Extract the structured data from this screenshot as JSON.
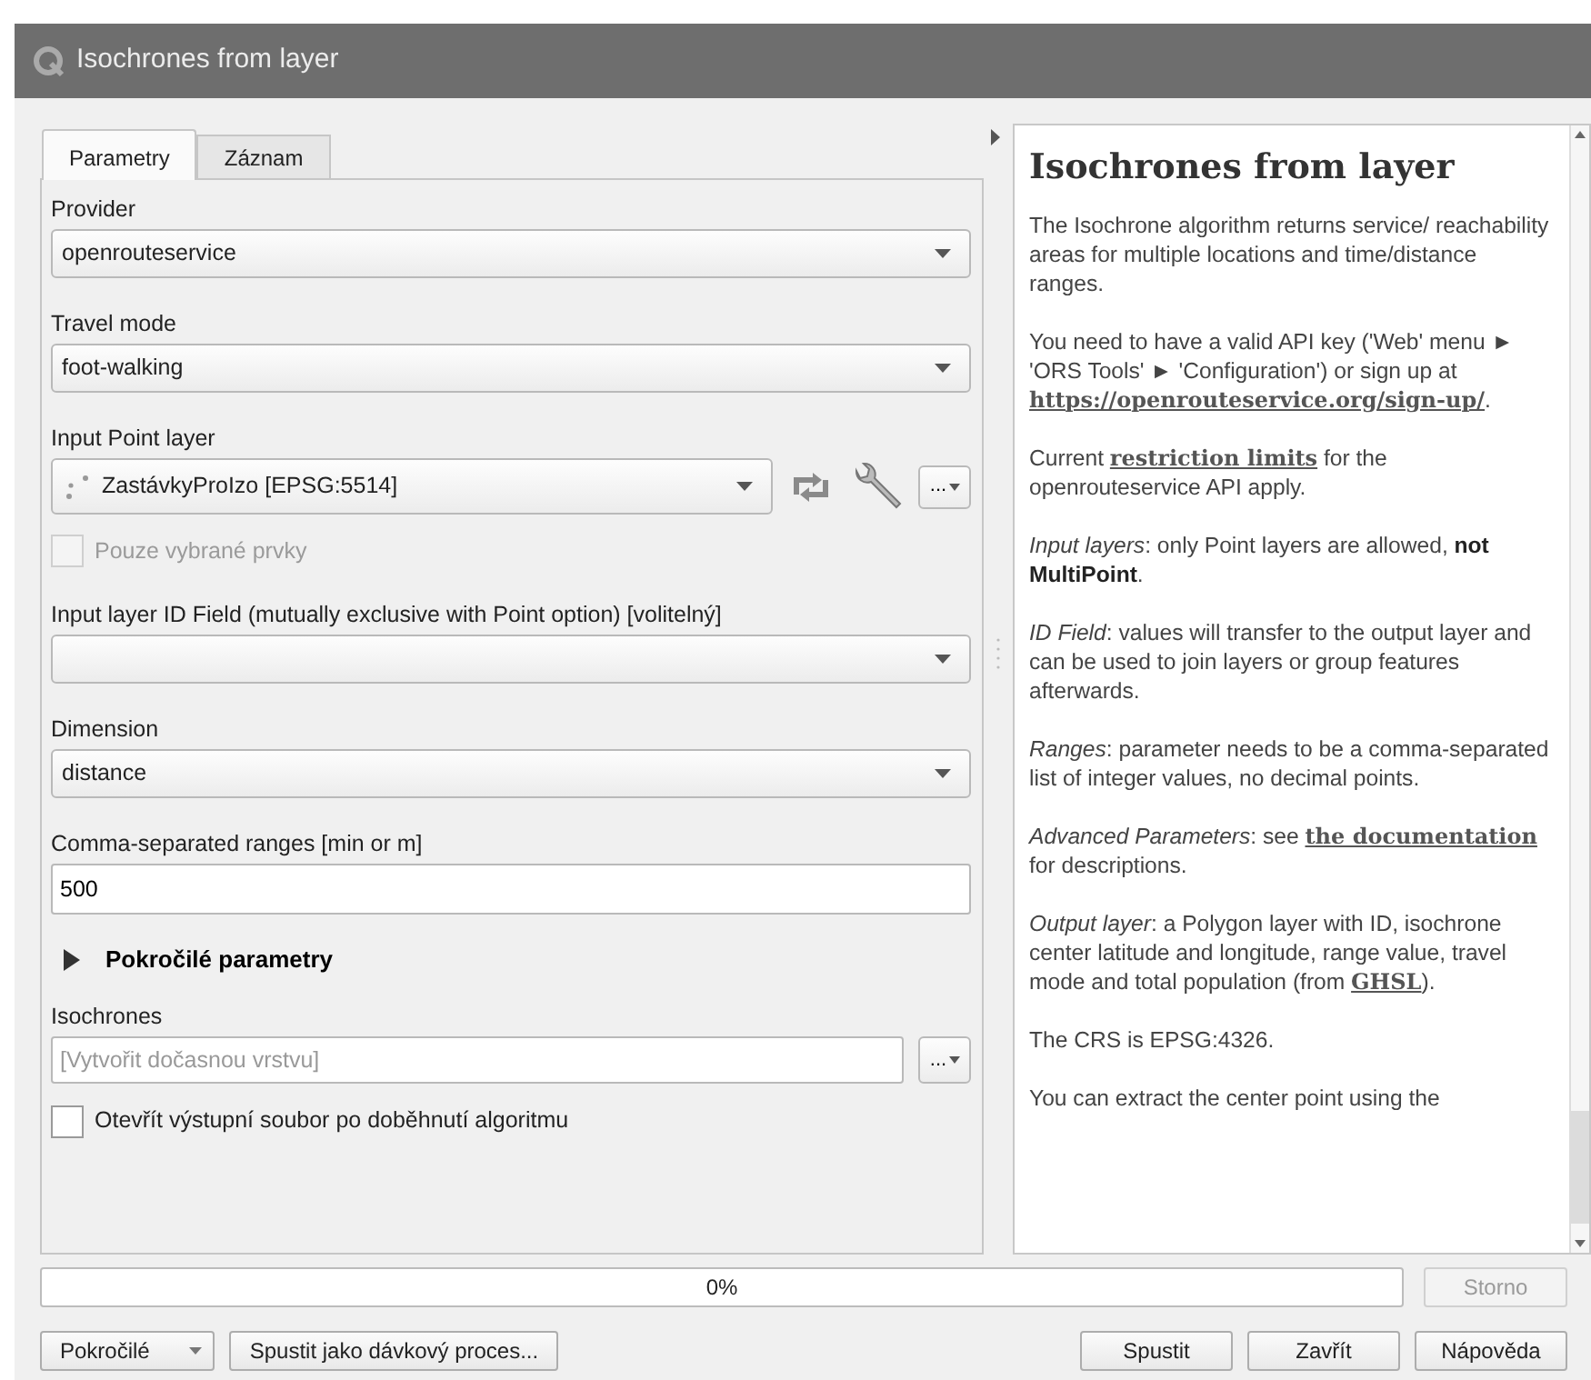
{
  "window": {
    "title": "Isochrones from layer"
  },
  "tabs": [
    {
      "label": "Parametry",
      "selected": true
    },
    {
      "label": "Záznam",
      "selected": false
    }
  ],
  "form": [
    {
      "kind": "combo",
      "label": "Provider",
      "value": "openrouteservice"
    },
    {
      "kind": "combo",
      "label": "Travel mode",
      "value": "foot-walking"
    },
    {
      "kind": "layer",
      "label": "Input Point layer",
      "value": "ZastávkyProIzo [EPSG:5514]",
      "button": "..."
    },
    {
      "kind": "checkbox",
      "label": "Pouze vybrané prvky",
      "checked": false,
      "disabled": true
    },
    {
      "kind": "combo",
      "label": "Input layer ID Field (mutually exclusive with Point option) [volitelný]"
    },
    {
      "kind": "combo",
      "label": "Dimension",
      "value": "distance"
    },
    {
      "kind": "text",
      "label": "Comma-separated ranges [min or m]",
      "value": "500"
    },
    {
      "kind": "section",
      "label": "Pokročilé parametry",
      "expanded": false
    },
    {
      "kind": "file",
      "label": "Isochrones",
      "placeholder": "[Vytvořit dočasnou vrstvu]",
      "button": "..."
    },
    {
      "kind": "checkbox",
      "label": "Otevřít výstupní soubor po doběhnutí algoritmu",
      "checked": false,
      "disabled": false
    }
  ],
  "help": {
    "title": "Isochrones from layer",
    "paragraphs": [
      [
        {
          "kind": "plain",
          "text": "The Isochrone algorithm returns service/ reachability areas for multiple locations and time/distance ranges."
        }
      ],
      [
        {
          "kind": "plain",
          "text": "You need to have a valid API key ('Web' menu ► 'ORS Tools' ► 'Configuration') or sign up at "
        },
        {
          "kind": "link",
          "text": "https://openrouteservice.org/sign-up/"
        },
        {
          "kind": "plain",
          "text": "."
        }
      ],
      [
        {
          "kind": "plain",
          "text": "Current "
        },
        {
          "kind": "link",
          "text": "restriction limits"
        },
        {
          "kind": "plain",
          "text": " for the openrouteservice API apply."
        }
      ],
      [
        {
          "kind": "italic",
          "text": "Input layers"
        },
        {
          "kind": "plain",
          "text": ": only Point layers are allowed, "
        },
        {
          "kind": "bold",
          "text": "not MultiPoint"
        },
        {
          "kind": "plain",
          "text": "."
        }
      ],
      [
        {
          "kind": "italic",
          "text": "ID Field"
        },
        {
          "kind": "plain",
          "text": ": values will transfer to the output layer and can be used to join layers or group features afterwards."
        }
      ],
      [
        {
          "kind": "italic",
          "text": "Ranges"
        },
        {
          "kind": "plain",
          "text": ": parameter needs to be a comma-separated list of integer values, no decimal points."
        }
      ],
      [
        {
          "kind": "italic",
          "text": "Advanced Parameters"
        },
        {
          "kind": "plain",
          "text": ": see "
        },
        {
          "kind": "link",
          "text": "the documentation"
        },
        {
          "kind": "plain",
          "text": " for descriptions."
        }
      ],
      [
        {
          "kind": "italic",
          "text": "Output layer"
        },
        {
          "kind": "plain",
          "text": ": a Polygon layer with ID, isochrone center latitude and longitude, range value, travel mode and total population (from "
        },
        {
          "kind": "link",
          "text": "GHSL"
        },
        {
          "kind": "plain",
          "text": ")."
        }
      ],
      [
        {
          "kind": "plain",
          "text": "The CRS is EPSG:4326."
        }
      ],
      [
        {
          "kind": "plain",
          "text": "You can extract the center point using the"
        }
      ]
    ]
  },
  "progress": {
    "level": 0,
    "reading": "0%",
    "cancel": {
      "label": "Storno",
      "disabled": true
    }
  },
  "buttons": [
    {
      "label": "Pokročilé",
      "kind": "split"
    },
    {
      "label": "Spustit jako dávkový proces...",
      "kind": "plain"
    },
    {
      "label": "Spustit",
      "kind": "plain"
    },
    {
      "label": "Zavřít",
      "kind": "plain"
    },
    {
      "label": "Nápověda",
      "kind": "plain"
    }
  ]
}
